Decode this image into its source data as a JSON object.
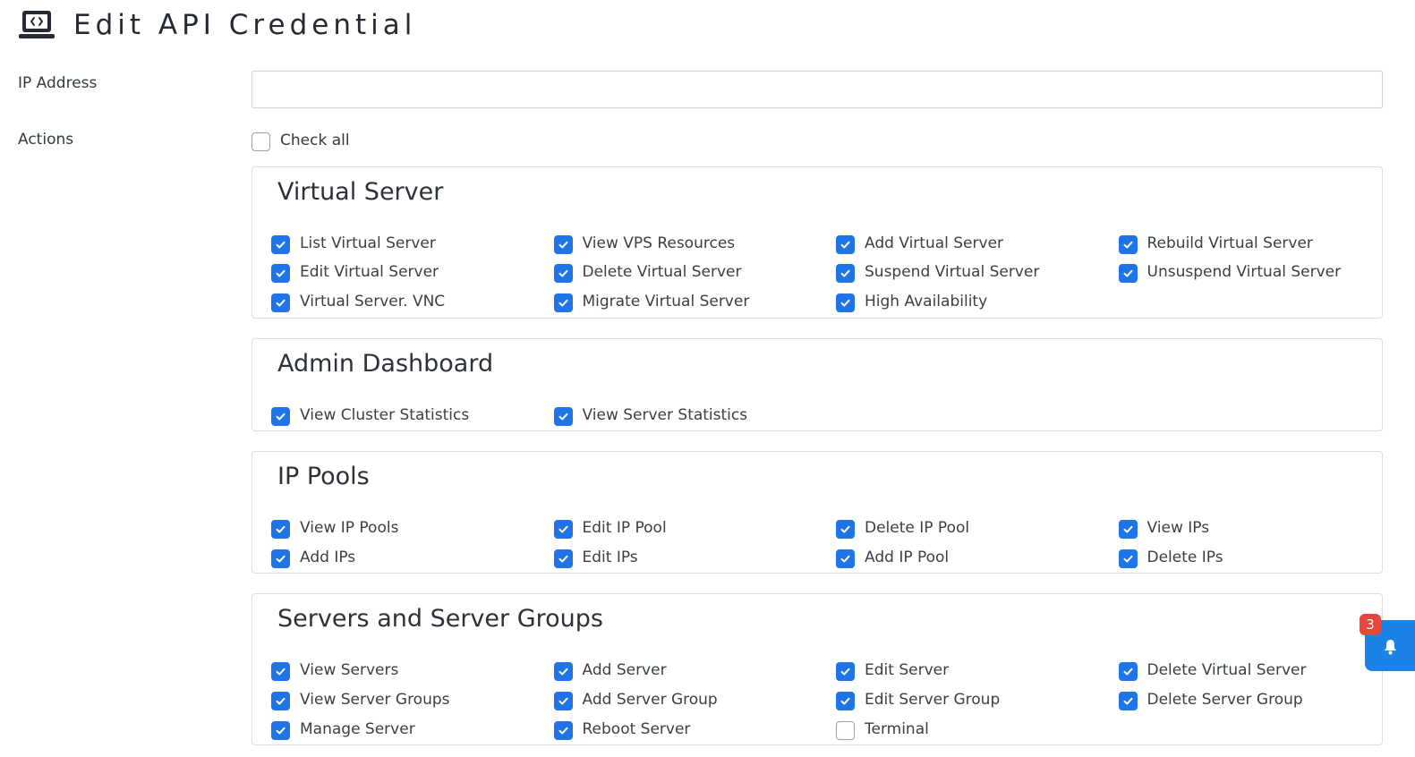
{
  "page": {
    "title": "Edit API Credential",
    "icon": "laptop-code-icon"
  },
  "form": {
    "ip_label": "IP Address",
    "ip_value": "",
    "actions_label": "Actions",
    "check_all_label": "Check all",
    "check_all_checked": false
  },
  "sections": [
    {
      "title": "Virtual Server",
      "rows": [
        [
          {
            "label": "List Virtual Server",
            "checked": true
          },
          {
            "label": "View VPS Resources",
            "checked": true
          },
          {
            "label": "Add Virtual Server",
            "checked": true
          },
          {
            "label": "Rebuild Virtual Server",
            "checked": true
          }
        ],
        [
          {
            "label": "Edit Virtual Server",
            "checked": true
          },
          {
            "label": "Delete Virtual Server",
            "checked": true
          },
          {
            "label": "Suspend Virtual Server",
            "checked": true
          },
          {
            "label": "Unsuspend Virtual Server",
            "checked": true
          }
        ],
        [
          {
            "label": "Virtual Server. VNC",
            "checked": true
          },
          {
            "label": "Migrate Virtual Server",
            "checked": true
          },
          {
            "label": "High Availability",
            "checked": true
          }
        ]
      ]
    },
    {
      "title": "Admin Dashboard",
      "rows": [
        [
          {
            "label": "View Cluster Statistics",
            "checked": true
          },
          {
            "label": "View Server Statistics",
            "checked": true
          }
        ]
      ]
    },
    {
      "title": "IP Pools",
      "rows": [
        [
          {
            "label": "View IP Pools",
            "checked": true
          },
          {
            "label": "Edit IP Pool",
            "checked": true
          },
          {
            "label": "Delete IP Pool",
            "checked": true
          },
          {
            "label": "View IPs",
            "checked": true
          }
        ],
        [
          {
            "label": "Add IPs",
            "checked": true
          },
          {
            "label": "Edit IPs",
            "checked": true
          },
          {
            "label": "Add IP Pool",
            "checked": true
          },
          {
            "label": "Delete IPs",
            "checked": true
          }
        ]
      ]
    },
    {
      "title": "Servers and Server Groups",
      "rows": [
        [
          {
            "label": "View Servers",
            "checked": true
          },
          {
            "label": "Add Server",
            "checked": true
          },
          {
            "label": "Edit Server",
            "checked": true
          },
          {
            "label": "Delete Virtual Server",
            "checked": true
          }
        ],
        [
          {
            "label": "View Server Groups",
            "checked": true
          },
          {
            "label": "Add Server Group",
            "checked": true
          },
          {
            "label": "Edit Server Group",
            "checked": true
          },
          {
            "label": "Delete Server Group",
            "checked": true
          }
        ],
        [
          {
            "label": "Manage Server",
            "checked": true
          },
          {
            "label": "Reboot Server",
            "checked": true
          },
          {
            "label": "Terminal",
            "checked": false
          }
        ]
      ]
    }
  ],
  "notifications": {
    "count": "3",
    "icon": "bell-icon"
  },
  "colors": {
    "accent": "#1f75e8",
    "badge": "#e8453c",
    "notif_tab": "#1c83e6"
  }
}
